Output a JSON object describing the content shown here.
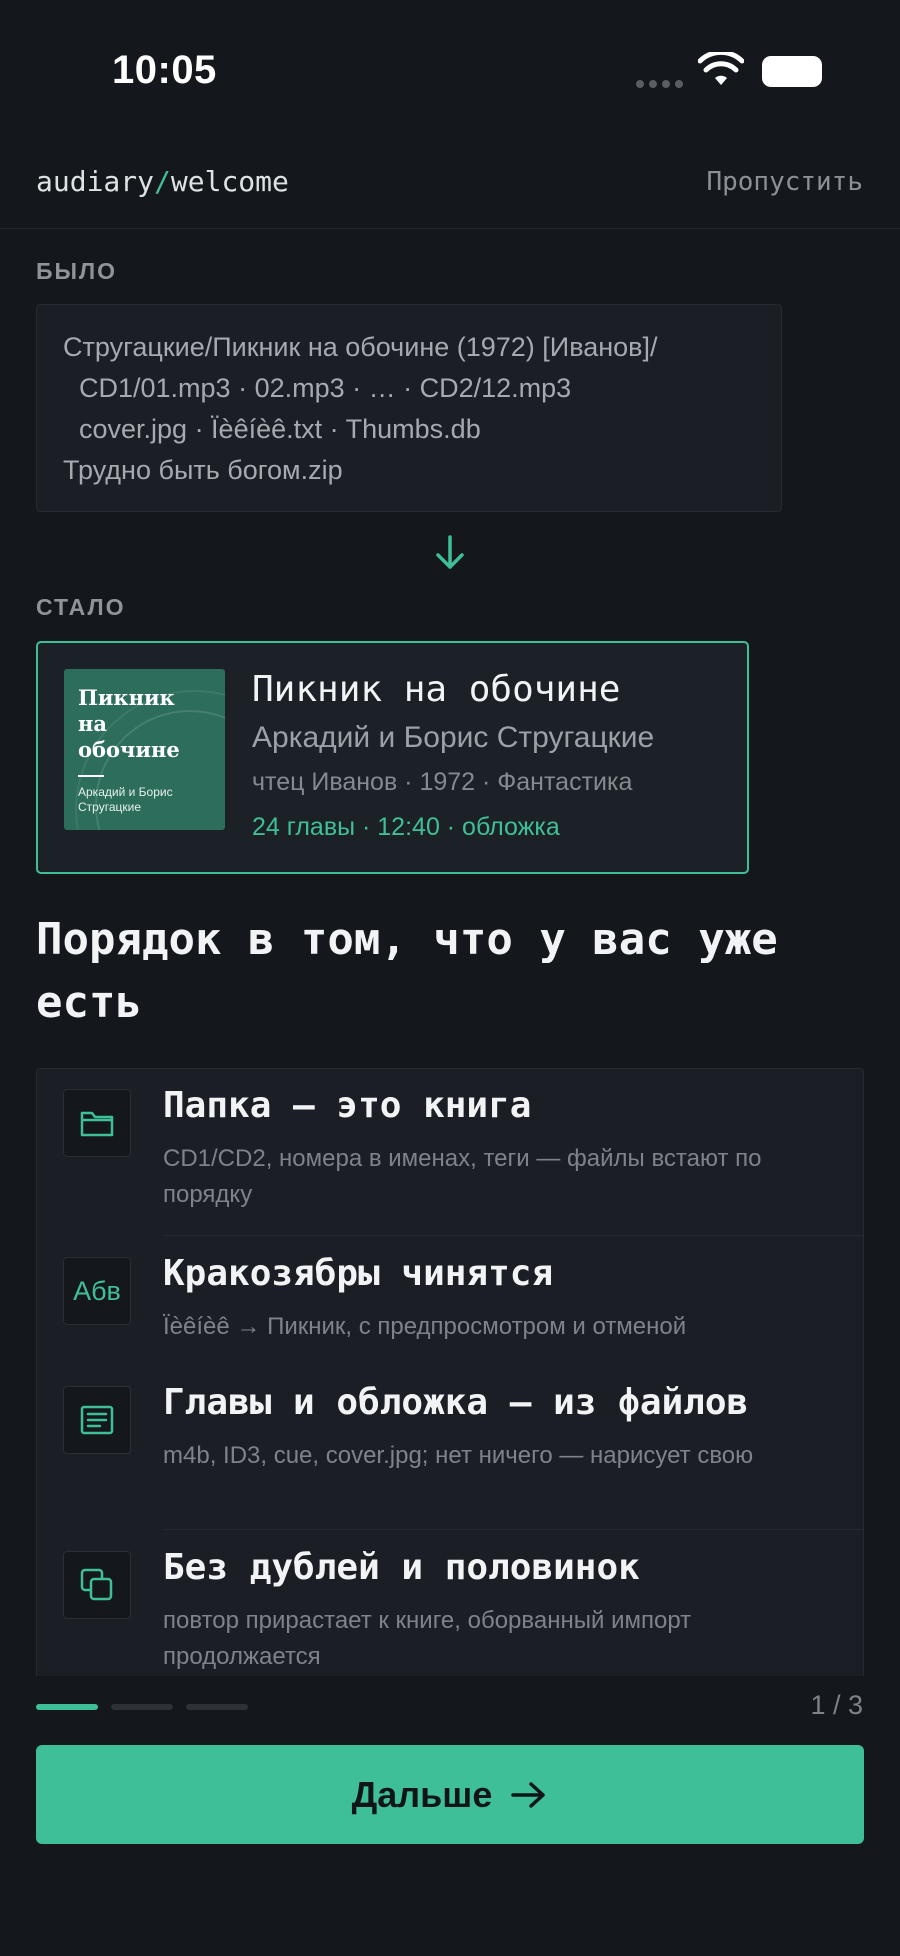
{
  "status_bar": {
    "time": "10:05"
  },
  "header": {
    "path_prefix": "audiary",
    "path_sep": "/",
    "path_page": "welcome",
    "skip_label": "Пропустить"
  },
  "before": {
    "label": "БЫЛО",
    "lines": [
      "Стругацкие/Пикник на обочине (1972) [Иванов]/",
      "CD1/01.mp3 · 02.mp3 · … · CD2/12.mp3",
      "cover.jpg · Ïèêíèê.txt · Thumbs.db",
      "Трудно быть богом.zip"
    ]
  },
  "after": {
    "label": "СТАЛО",
    "cover": {
      "title": "Пикник на обочине",
      "author": "Аркадий и Борис Стругацкие"
    },
    "title": "Пикник на обочине",
    "author": "Аркадий и Борис Стругацкие",
    "meta": "чтец Иванов · 1972 · Фантастика",
    "stats": "24 главы · 12:40 · обложка"
  },
  "headline": "Порядок в том, что у вас уже есть",
  "features": [
    {
      "icon": "folder-icon",
      "title": "Папка — это книга",
      "desc": "CD1/CD2, номера в именах, теги — файлы встают по порядку"
    },
    {
      "icon": "encoding-icon",
      "icon_text": "Абв",
      "title": "Кракозябры чинятся",
      "desc": "Ïèêíèê → Пикник, с предпросмотром и отменой"
    },
    {
      "icon": "chapters-list-icon",
      "title": "Главы и обложка — из файлов",
      "desc": "m4b, ID3, cue, cover.jpg; нет ничего — нарисует свою"
    },
    {
      "icon": "duplicate-icon",
      "title": "Без дублей и половинок",
      "desc": "повтор прирастает к книге, оборванный импорт продолжается"
    }
  ],
  "pager": {
    "current": 1,
    "total": 3,
    "counter": "1 / 3"
  },
  "next_button": {
    "label": "Дальше"
  },
  "colors": {
    "accent": "#3fbf97",
    "background": "#14171c",
    "card": "#1b1f25"
  }
}
